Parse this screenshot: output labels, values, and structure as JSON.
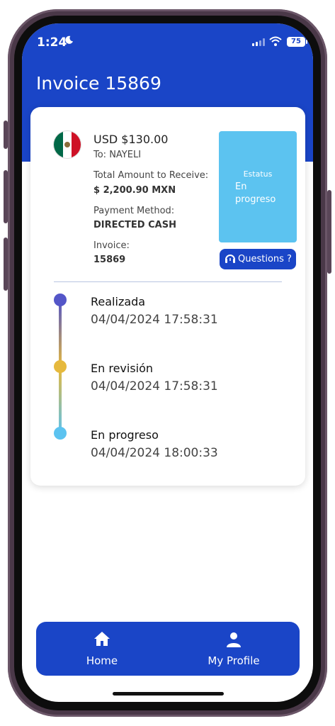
{
  "status_bar": {
    "time": "1:24",
    "battery": "75"
  },
  "header": {
    "title": "Invoice 15869"
  },
  "invoice": {
    "amount": "USD $130.00",
    "to": "To: NAYELI",
    "total_label": "Total Amount to Receive:",
    "total_value": "$ 2,200.90 MXN",
    "payment_label": "Payment Method:",
    "payment_value": "DIRECTED CASH",
    "invoice_label": "Invoice:",
    "invoice_value": "15869"
  },
  "status_box": {
    "title": "Estatus",
    "value": "En progreso",
    "color": "#5cc3f0"
  },
  "questions_label": "Questions ?",
  "timeline": [
    {
      "name": "Realizada",
      "date": "04/04/2024 17:58:31",
      "color": "#5456c8"
    },
    {
      "name": "En revisión",
      "date": "04/04/2024 17:58:31",
      "color": "#e6b93d"
    },
    {
      "name": "En progreso",
      "date": "04/04/2024 18:00:33",
      "color": "#5cc3f0"
    }
  ],
  "bottom_nav": [
    {
      "label": "Home",
      "icon": "home-icon"
    },
    {
      "label": "My Profile",
      "icon": "person-icon"
    }
  ],
  "colors": {
    "primary": "#1a45c7"
  }
}
